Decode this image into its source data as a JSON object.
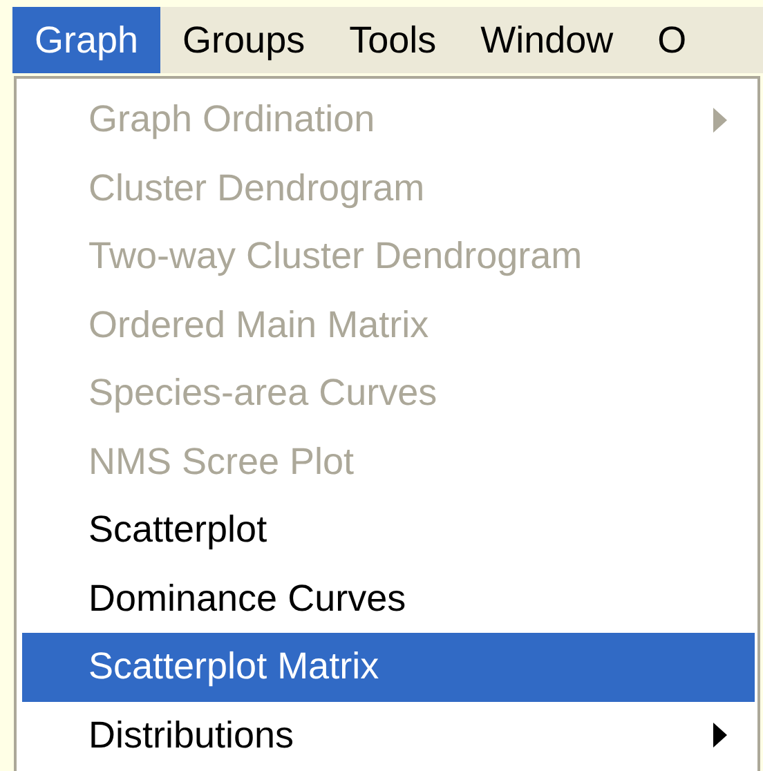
{
  "menubar": [
    {
      "label": "Graph",
      "selected": true
    },
    {
      "label": "Groups",
      "selected": false
    },
    {
      "label": "Tools",
      "selected": false
    },
    {
      "label": "Window",
      "selected": false
    },
    {
      "label": "O",
      "selected": false
    }
  ],
  "menu": {
    "items": [
      {
        "label": "Graph Ordination",
        "disabled": true,
        "selected": false,
        "submenu": true
      },
      {
        "label": "Cluster Dendrogram",
        "disabled": true,
        "selected": false,
        "submenu": false
      },
      {
        "label": "Two-way Cluster Dendrogram",
        "disabled": true,
        "selected": false,
        "submenu": false
      },
      {
        "label": "Ordered Main Matrix",
        "disabled": true,
        "selected": false,
        "submenu": false
      },
      {
        "label": "Species-area Curves",
        "disabled": true,
        "selected": false,
        "submenu": false
      },
      {
        "label": "NMS Scree Plot",
        "disabled": true,
        "selected": false,
        "submenu": false
      },
      {
        "label": "Scatterplot",
        "disabled": false,
        "selected": false,
        "submenu": false
      },
      {
        "label": "Dominance Curves",
        "disabled": false,
        "selected": false,
        "submenu": false
      },
      {
        "label": "Scatterplot Matrix",
        "disabled": false,
        "selected": true,
        "submenu": false
      },
      {
        "label": "Distributions",
        "disabled": false,
        "selected": false,
        "submenu": true
      }
    ]
  }
}
